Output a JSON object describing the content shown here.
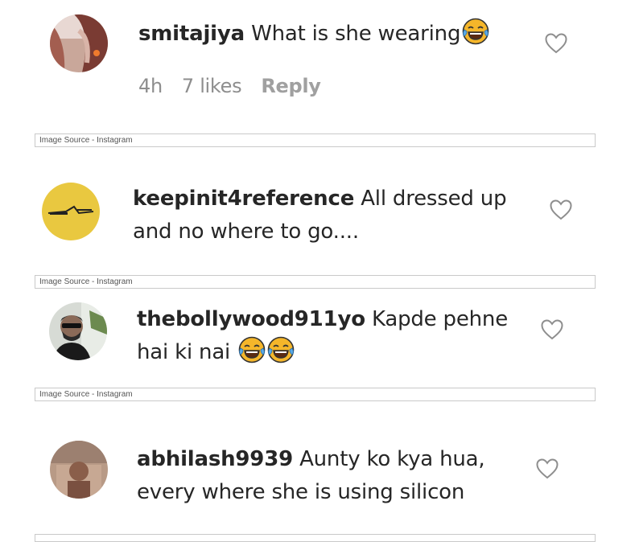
{
  "comments": [
    {
      "username": "smitajiya",
      "text": "What is she wearing",
      "emoji_count": 1,
      "meta": {
        "time": "4h",
        "likes": "7 likes",
        "reply": "Reply"
      }
    },
    {
      "username": "keepinit4reference",
      "text_line1": "All dressed up",
      "text_line2": "and no where to go...."
    },
    {
      "username": "thebollywood911yo",
      "text_line1": "Kapde pehne",
      "text_line2": "hai ki nai",
      "emoji_count": 2
    },
    {
      "username": "abhilash9939",
      "text_line1": "Aunty ko kya hua,",
      "text_line2": "every where she is using silicon"
    }
  ],
  "image_source_label": "Image Source - Instagram",
  "icons": {
    "heart": "heart-outline-icon",
    "emoji": "face-with-tears-of-joy-emoji"
  },
  "colors": {
    "text": "#262626",
    "meta": "#8e8e8e",
    "emoji_face": "#f5b62a",
    "emoji_tears": "#5aa9e6"
  }
}
